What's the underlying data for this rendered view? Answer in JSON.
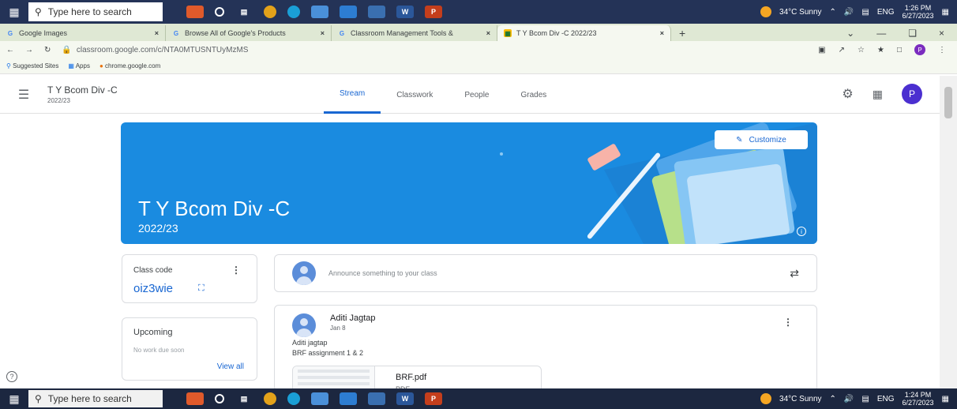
{
  "taskbar_top": {
    "search_placeholder": "Type here to search",
    "weather": "34°C  Sunny",
    "lang": "ENG",
    "time": "1:26 PM",
    "date": "6/27/2023"
  },
  "browser": {
    "tabs": [
      {
        "label": "Google Images",
        "active": false
      },
      {
        "label": "Browse All of Google's Products",
        "active": false
      },
      {
        "label": "Classroom Management Tools &",
        "active": false
      },
      {
        "label": "T Y Bcom Div -C 2022/23",
        "active": true
      }
    ],
    "url": "classroom.google.com/c/NTA0MTUSNTUyMzMS",
    "bookmarks": [
      "Suggested Sites",
      "Apps",
      "chrome.google.com"
    ],
    "profile_initial": "P"
  },
  "classroom": {
    "class_name": "T Y Bcom Div -C",
    "class_year": "2022/23",
    "nav_tabs": [
      "Stream",
      "Classwork",
      "People",
      "Grades"
    ],
    "avatar_initial": "P",
    "banner": {
      "title": "T Y Bcom Div -C",
      "subtitle": "2022/23",
      "customize_label": "Customize"
    },
    "class_code": {
      "label": "Class code",
      "value": "oiz3wie"
    },
    "upcoming": {
      "label": "Upcoming",
      "status": "No work due soon",
      "link": "View all"
    },
    "announce_placeholder": "Announce something to your class",
    "post": {
      "author": "Aditi Jagtap",
      "date": "Jan 8",
      "line1": "Aditi jagtap",
      "line2": "BRF assignment 1 & 2",
      "attachment_name": "BRF.pdf",
      "attachment_type": "PDF"
    }
  },
  "taskbar_bottom": {
    "search_placeholder": "Type here to search",
    "weather": "34°C  Sunny",
    "lang": "ENG",
    "time": "1:24 PM",
    "date": "6/27/2023"
  }
}
